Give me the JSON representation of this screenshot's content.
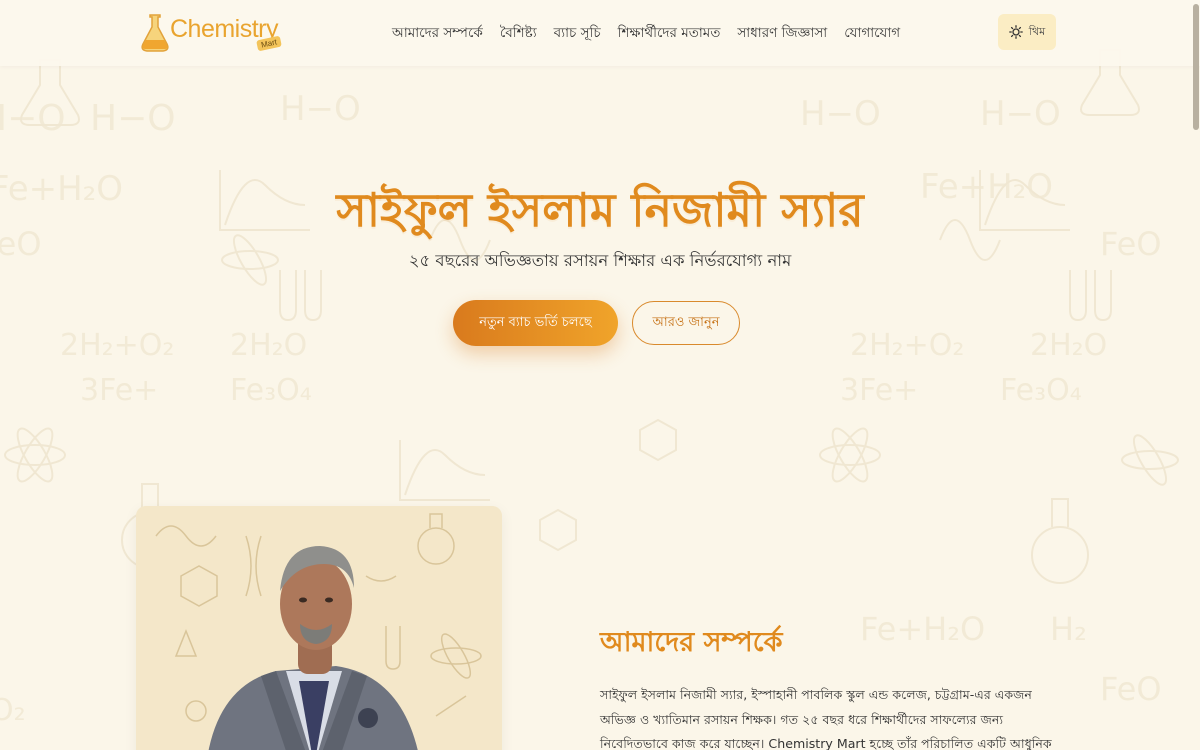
{
  "brand": {
    "logo_text": "Chemistry",
    "logo_tag": "Mart",
    "accent": "#e08a1e"
  },
  "nav": {
    "links": [
      "আমাদের সম্পর্কে",
      "বৈশিষ্ট্য",
      "ব্যাচ সূচি",
      "শিক্ষার্থীদের মতামত",
      "সাধারণ জিজ্ঞাসা",
      "যোগাযোগ"
    ],
    "theme_label": "থিম",
    "theme_icon": "sun-icon"
  },
  "hero": {
    "title": "সাইফুল ইসলাম নিজামী স্যার",
    "subtitle": "২৫ বছরের অভিজ্ঞতায় রসায়ন শিক্ষার এক নির্ভরযোগ্য নাম",
    "primary_button": "নতুন ব্যাচ ভর্তি চলছে",
    "secondary_button": "আরও জানুন"
  },
  "about": {
    "heading": "আমাদের সম্পর্কে",
    "text": "সাইফুল ইসলাম নিজামী স্যার, ইস্পাহানী পাবলিক স্কুল এন্ড কলেজ, চট্টগ্রাম-এর একজন অভিজ্ঞ ও খ্যাতিমান রসায়ন শিক্ষক। গত ২৫ বছর ধরে শিক্ষার্থীদের সাফল্যের জন্য নিবেদিতভাবে কাজ করে যাচ্ছেন। Chemistry Mart হচ্ছে তাঁর পরিচালিত একটি আধুনিক কোচিং প্ল্যাটফর্ম যেখানে"
  }
}
